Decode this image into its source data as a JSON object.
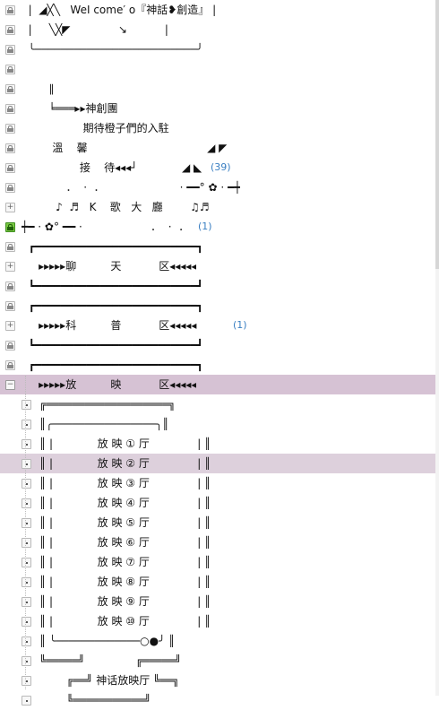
{
  "rows": [
    {
      "icon": "lock",
      "text": "  |  ◢╳╲   WeI come′ o『神話❥創造』 |"
    },
    {
      "icon": "lock",
      "text": "  |     ╲╳◤              ↘           |"
    },
    {
      "icon": "lock",
      "text": "  ╰─────────────────────────╯"
    },
    {
      "icon": "lock",
      "text": ""
    },
    {
      "icon": "lock",
      "text": "        ∥"
    },
    {
      "icon": "lock",
      "text": "        ╘═══▸▸神創團"
    },
    {
      "icon": "lock",
      "text": "                  期待橙子們的入駐"
    },
    {
      "icon": "lock",
      "text": "         溫    馨                                   ◢ ◤"
    },
    {
      "icon": "lock",
      "text": "                 接    待◂◂◂┘             ◢ ◣  ",
      "count": "(39)"
    },
    {
      "icon": "lock",
      "text": "             ．  ·  ．                      · ━━° ✿ · ━┿"
    },
    {
      "icon": "plus",
      "text": "          ♪  ♬   K    歌   大   廳        ♫♬"
    },
    {
      "icon": "lock-green",
      "text": "┿━ · ✿° ━━ ·                    ．  ·  ．  ",
      "count": "(1)"
    },
    {
      "icon": "lock",
      "text": "  ┏━━━━━━━━━━━━━━━━━━━━━━━━━┓"
    },
    {
      "icon": "plus",
      "text": "     ▸▸▸▸▸聊          天           区◂◂◂◂◂"
    },
    {
      "icon": "lock",
      "text": "  ┗━━━━━━━━━━━━━━━━━━━━━━━━━┛"
    },
    {
      "icon": "lock",
      "text": "  ┏━━━━━━━━━━━━━━━━━━━━━━━━━┓"
    },
    {
      "icon": "plus",
      "text": "     ▸▸▸▸▸科          普           区◂◂◂◂◂          ",
      "count": "(1)"
    },
    {
      "icon": "lock",
      "text": "  ┗━━━━━━━━━━━━━━━━━━━━━━━━━┛"
    },
    {
      "icon": "lock",
      "text": "  ┏━━━━━━━━━━━━━━━━━━━━━━━━━┓"
    },
    {
      "icon": "minus",
      "text": "     ▸▸▸▸▸放          映           区◂◂◂◂◂",
      "hl": "strong"
    },
    {
      "icon": "dot",
      "text": "╔═══════════════════╗"
    },
    {
      "icon": "dot",
      "text": "║╭────────────────╮║"
    },
    {
      "icon": "dot",
      "text": "║ |             放 映 ① 厅              | ║"
    },
    {
      "icon": "dot",
      "text": "║ |             放 映 ② 厅              | ║",
      "hl": "soft"
    },
    {
      "icon": "dot",
      "text": "║ |             放 映 ③ 厅              | ║"
    },
    {
      "icon": "dot",
      "text": "║ |             放 映 ④ 厅              | ║"
    },
    {
      "icon": "dot",
      "text": "║ |             放 映 ⑤ 厅              | ║"
    },
    {
      "icon": "dot",
      "text": "║ |             放 映 ⑥ 厅              | ║"
    },
    {
      "icon": "dot",
      "text": "║ |             放 映 ⑦ 厅              | ║"
    },
    {
      "icon": "dot",
      "text": "║ |             放 映 ⑧ 厅              | ║"
    },
    {
      "icon": "dot",
      "text": "║ |             放 映 ⑨ 厅              | ║"
    },
    {
      "icon": "dot",
      "text": "║ |             放 映 ⑩ 厅              | ║"
    },
    {
      "icon": "dot",
      "text": "║ ╰─────────────○●╯ ║"
    },
    {
      "icon": "dot",
      "text": "╚═════╝               ╔═════╝"
    },
    {
      "icon": "dot",
      "text": "        ╔══╝ 神话放映厅 ╚══╗"
    },
    {
      "icon": "dot",
      "text": "        ╚═══════════╝"
    }
  ]
}
